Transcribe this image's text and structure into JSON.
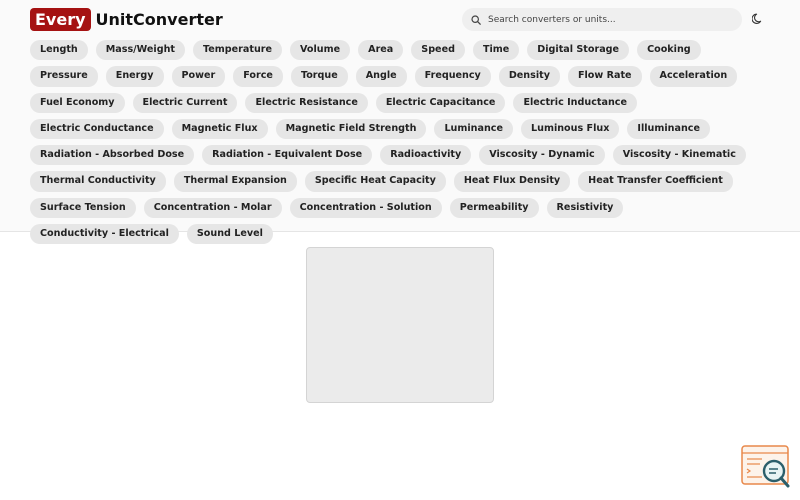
{
  "brand": {
    "badge": "Every",
    "name": "UnitConverter",
    "accent": "#a51212"
  },
  "search": {
    "placeholder": "Search converters or units..."
  },
  "icons": {
    "search": "search-icon",
    "theme": "moon-icon",
    "widget": "document-search-icon"
  },
  "categories": [
    "Length",
    "Mass/Weight",
    "Temperature",
    "Volume",
    "Area",
    "Speed",
    "Time",
    "Digital Storage",
    "Cooking",
    "Pressure",
    "Energy",
    "Power",
    "Force",
    "Torque",
    "Angle",
    "Frequency",
    "Density",
    "Flow Rate",
    "Acceleration",
    "Fuel Economy",
    "Electric Current",
    "Electric Resistance",
    "Electric Capacitance",
    "Electric Inductance",
    "Electric Conductance",
    "Magnetic Flux",
    "Magnetic Field Strength",
    "Luminance",
    "Luminous Flux",
    "Illuminance",
    "Radiation - Absorbed Dose",
    "Radiation - Equivalent Dose",
    "Radioactivity",
    "Viscosity - Dynamic",
    "Viscosity - Kinematic",
    "Thermal Conductivity",
    "Thermal Expansion",
    "Specific Heat Capacity",
    "Heat Flux Density",
    "Heat Transfer Coefficient",
    "Surface Tension",
    "Concentration - Molar",
    "Concentration - Solution",
    "Permeability",
    "Resistivity",
    "Conductivity - Electrical",
    "Sound Level"
  ]
}
